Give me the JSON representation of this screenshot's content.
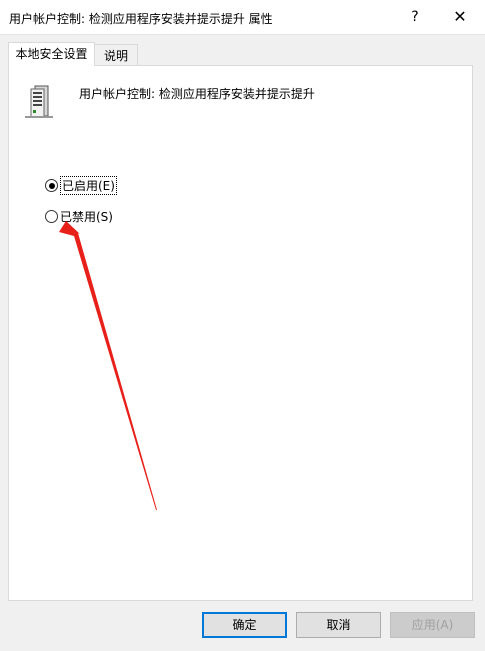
{
  "window": {
    "title": "用户帐户控制: 检测应用程序安装并提示提升 属性",
    "help_glyph": "?",
    "close_glyph": "✕"
  },
  "tabs": [
    {
      "label": "本地安全设置",
      "active": true
    },
    {
      "label": "说明",
      "active": false
    }
  ],
  "policy": {
    "name": "用户帐户控制: 检测应用程序安装并提示提升",
    "icon": "server-icon"
  },
  "options": [
    {
      "label": "已启用(E)",
      "checked": true
    },
    {
      "label": "已禁用(S)",
      "checked": false
    }
  ],
  "buttons": {
    "ok": "确定",
    "cancel": "取消",
    "apply": "应用(A)"
  },
  "annotation": {
    "color": "#e8201a"
  }
}
